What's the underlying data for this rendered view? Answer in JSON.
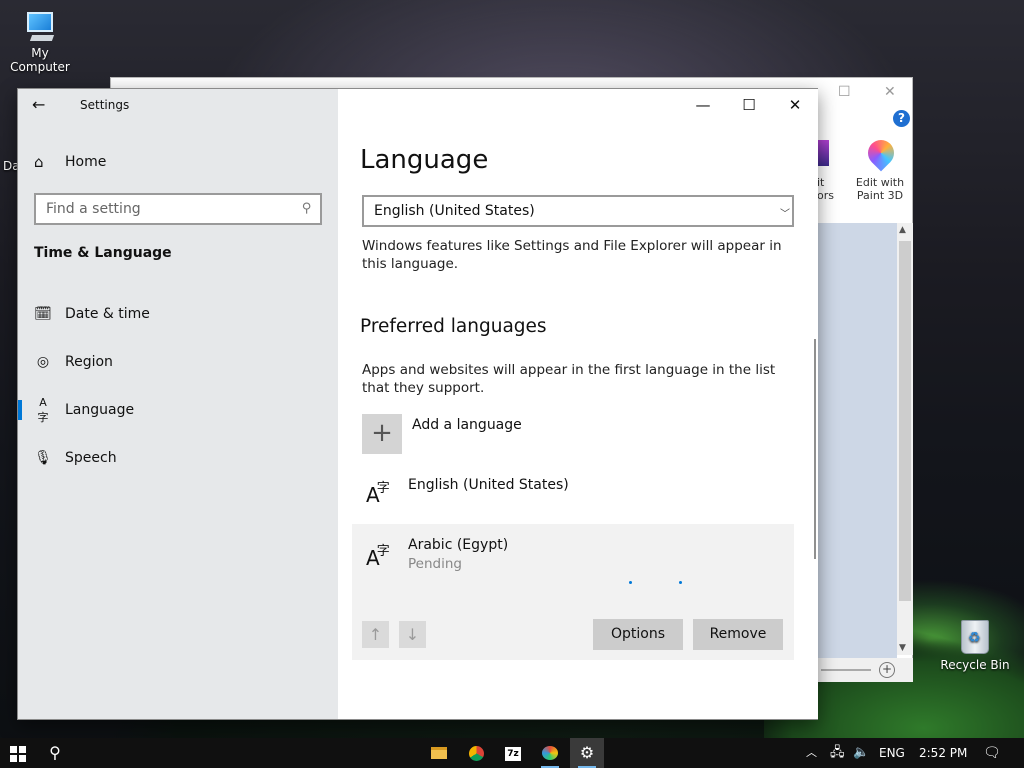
{
  "desktop": {
    "icons": [
      {
        "label": "My Computer"
      },
      {
        "label": "Recycle Bin"
      }
    ],
    "partial_label": "Da"
  },
  "background_window": {
    "ribbon": {
      "colors_partial_1": "it",
      "colors_partial_2": "ors",
      "paint3d_line1": "Edit with",
      "paint3d_line2": "Paint 3D"
    },
    "help_label": "?"
  },
  "settings": {
    "app_title": "Settings",
    "home_label": "Home",
    "search_placeholder": "Find a setting",
    "section_title": "Time & Language",
    "nav_items": [
      {
        "label": "Date & time"
      },
      {
        "label": "Region"
      },
      {
        "label": "Language"
      },
      {
        "label": "Speech"
      }
    ],
    "active_nav": "Language",
    "page_title": "Language",
    "windows_display_language": "English (United States)",
    "windows_display_desc": "Windows features like Settings and File Explorer will appear in this language.",
    "preferred_heading": "Preferred languages",
    "preferred_desc": "Apps and websites will appear in the first language in the list that they support.",
    "add_language_label": "Add a language",
    "languages": [
      {
        "name": "English (United States)",
        "status": ""
      },
      {
        "name": "Arabic (Egypt)",
        "status": "Pending"
      }
    ],
    "options_label": "Options",
    "remove_label": "Remove"
  },
  "taskbar": {
    "language": "ENG",
    "time": "2:52 PM",
    "accent": "#0078d7"
  }
}
